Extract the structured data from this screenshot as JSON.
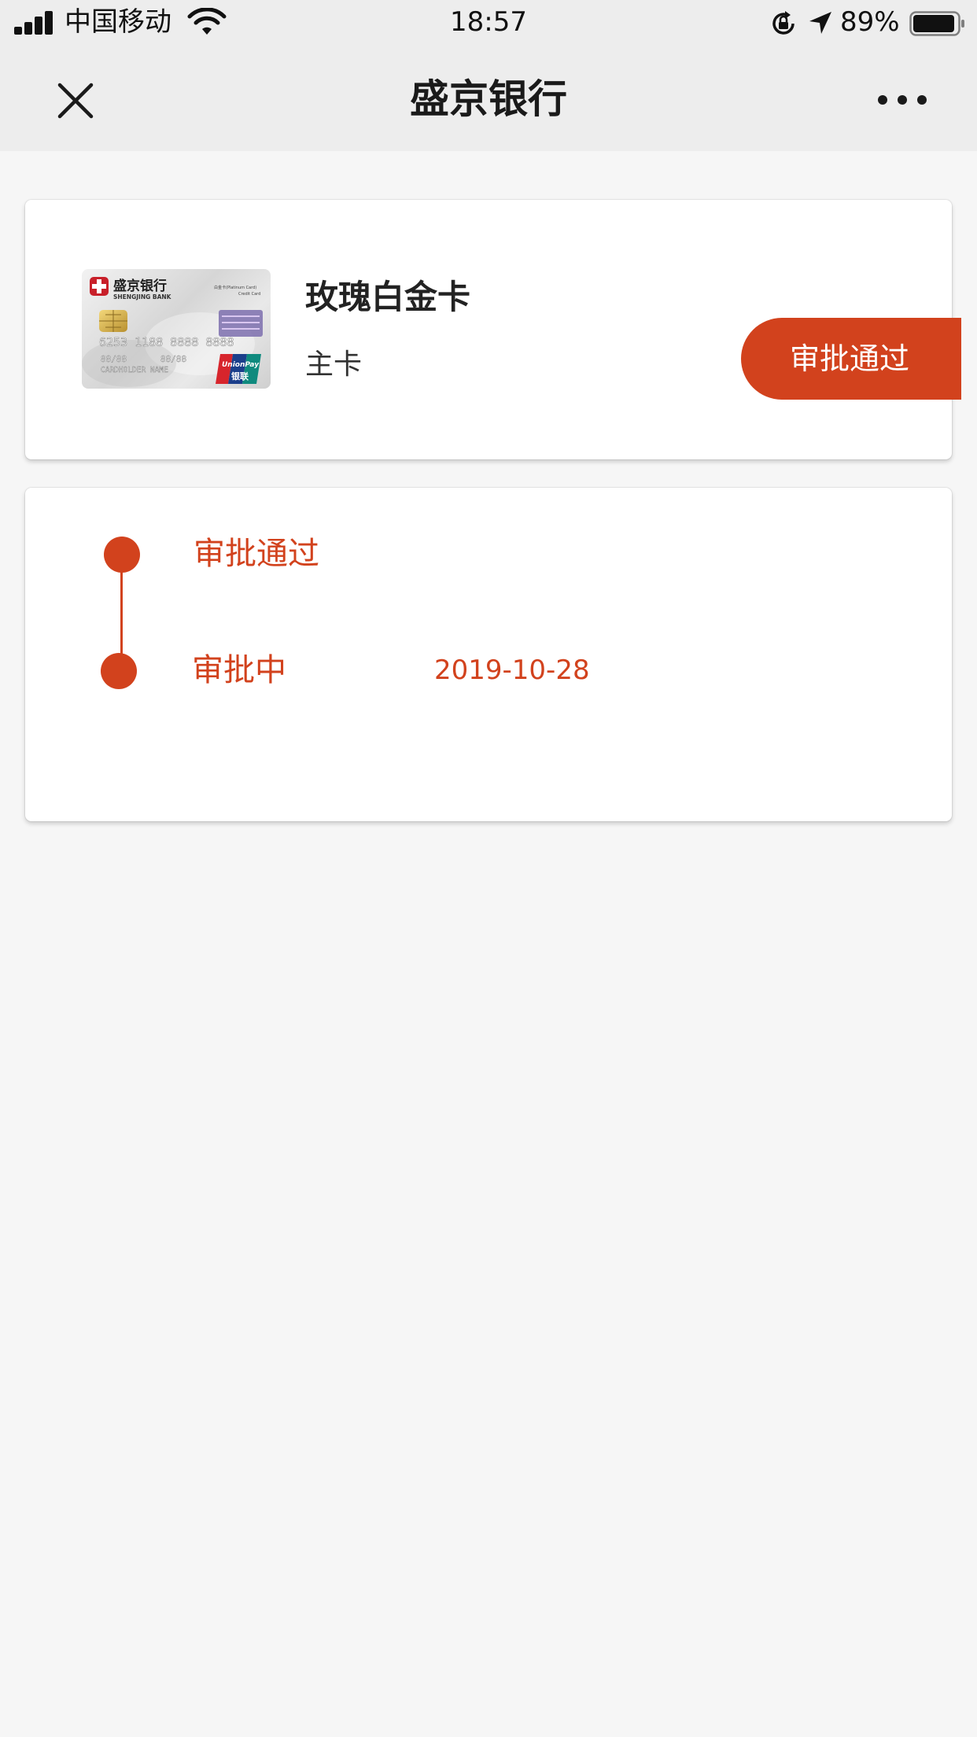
{
  "status_bar": {
    "carrier": "中国移动",
    "time": "18:57",
    "battery_percent": "89%",
    "icons": [
      "signal-icon",
      "wifi-icon",
      "rotation-lock-icon",
      "location-icon",
      "battery-icon"
    ]
  },
  "nav": {
    "title": "盛京银行",
    "close_icon": "close-icon",
    "more_icon": "more-icon"
  },
  "card": {
    "name": "玫瑰白金卡",
    "type": "主卡",
    "status": "审批通过",
    "image_text": {
      "bank_name_cn": "盛京银行",
      "bank_name_en": "SHENGJING BANK",
      "card_label": "白金卡(Platinum Card)",
      "card_sub": "Credit Card",
      "number": "6253 1188 8888 8888",
      "holder": "CARDHOLDER NAME",
      "network": "UnionPay",
      "network_cn": "银联"
    }
  },
  "timeline": {
    "steps": [
      {
        "label": "审批通过",
        "date": ""
      },
      {
        "label": "审批中",
        "date": "2019-10-28"
      }
    ]
  },
  "colors": {
    "accent": "#d2421d",
    "background": "#f6f6f6",
    "bar": "#ededed"
  }
}
